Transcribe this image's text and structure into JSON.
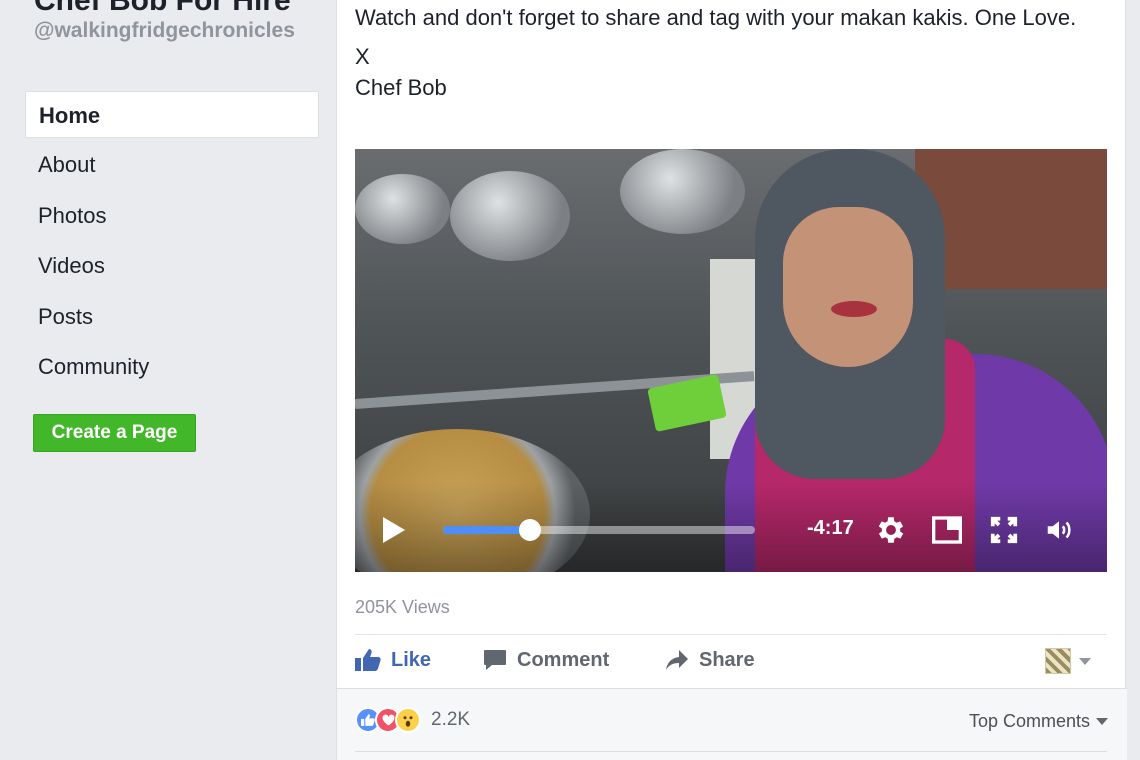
{
  "page": {
    "name": "Chef Bob For Hire",
    "handle": "@walkingfridgechronicles"
  },
  "nav": {
    "items": [
      {
        "label": "Home",
        "active": true
      },
      {
        "label": "About"
      },
      {
        "label": "Photos"
      },
      {
        "label": "Videos"
      },
      {
        "label": "Posts"
      },
      {
        "label": "Community"
      }
    ],
    "create_page_label": "Create a Page"
  },
  "post": {
    "lines": [
      "Watch and don't forget to share and tag with your makan kakis. One Love.",
      "X",
      "Chef Bob"
    ],
    "video": {
      "time_remaining": "-4:17",
      "progress": 0.28,
      "icons": [
        "play-icon",
        "gear-icon",
        "picture-in-picture-icon",
        "fullscreen-icon",
        "volume-icon"
      ]
    },
    "views": "205K Views",
    "actions": {
      "like": "Like",
      "comment": "Comment",
      "share": "Share"
    },
    "reactions": {
      "types": [
        "like",
        "love",
        "wow"
      ],
      "count": "2.2K"
    },
    "top_comments_label": "Top Comments"
  },
  "colors": {
    "background": "#e9ebee",
    "brand_blue": "#4267b2",
    "create_green": "#42b72a",
    "progress_blue": "#4f8ef7"
  }
}
